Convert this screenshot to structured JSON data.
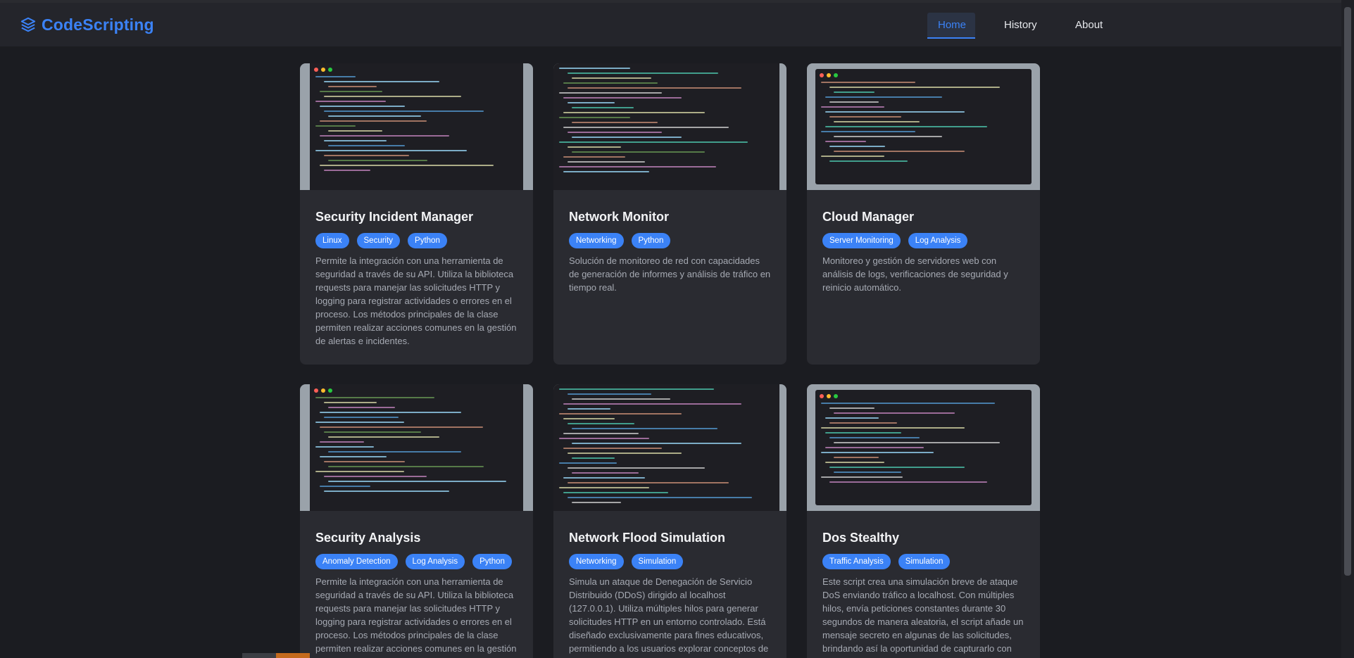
{
  "brand": {
    "name": "CodeScripting",
    "icon": "layers-icon",
    "color": "#3b82f6"
  },
  "nav": {
    "items": [
      {
        "label": "Home",
        "active": true
      },
      {
        "label": "History",
        "active": false
      },
      {
        "label": "About",
        "active": false
      }
    ]
  },
  "cards": [
    {
      "title": "Security Incident Manager",
      "tags": [
        "Linux",
        "Security",
        "Python"
      ],
      "description": "Permite la integración con una herramienta de seguridad a través de su API. Utiliza la biblioteca requests para manejar las solicitudes HTTP y logging para registrar actividades o errores en el proceso. Los métodos principales de la clase permiten realizar acciones comunes en la gestión de alertas e incidentes."
    },
    {
      "title": "Network Monitor",
      "tags": [
        "Networking",
        "Python"
      ],
      "description": "Solución de monitoreo de red con capacidades de generación de informes y análisis de tráfico en tiempo real."
    },
    {
      "title": "Cloud Manager",
      "tags": [
        "Server Monitoring",
        "Log Analysis"
      ],
      "description": "Monitoreo y gestión de servidores web con análisis de logs, verificaciones de seguridad y reinicio automático."
    },
    {
      "title": "Security Analysis",
      "tags": [
        "Anomaly Detection",
        "Log Analysis",
        "Python"
      ],
      "description": "Permite la integración con una herramienta de seguridad a través de su API. Utiliza la biblioteca requests para manejar las solicitudes HTTP y logging para registrar actividades o errores en el proceso. Los métodos principales de la clase permiten realizar acciones comunes en la gestión"
    },
    {
      "title": "Network Flood Simulation",
      "tags": [
        "Networking",
        "Simulation"
      ],
      "description": "Simula un ataque de Denegación de Servicio Distribuido (DDoS) dirigido al localhost (127.0.0.1). Utiliza múltiples hilos para generar solicitudes HTTP en un entorno controlado. Está diseñado exclusivamente para fines educativos, permitiendo a los usuarios explorar conceptos de"
    },
    {
      "title": "Dos Stealthy",
      "tags": [
        "Traffic Analysis",
        "Simulation"
      ],
      "description": "Este script crea una simulación breve de ataque DoS enviando tráfico a localhost. Con múltiples hilos, envía peticiones constantes durante 30 segundos de manera aleatoria, el script añade un mensaje secreto en algunas de las solicitudes, brindando así la oportunidad de capturarlo con"
    }
  ]
}
